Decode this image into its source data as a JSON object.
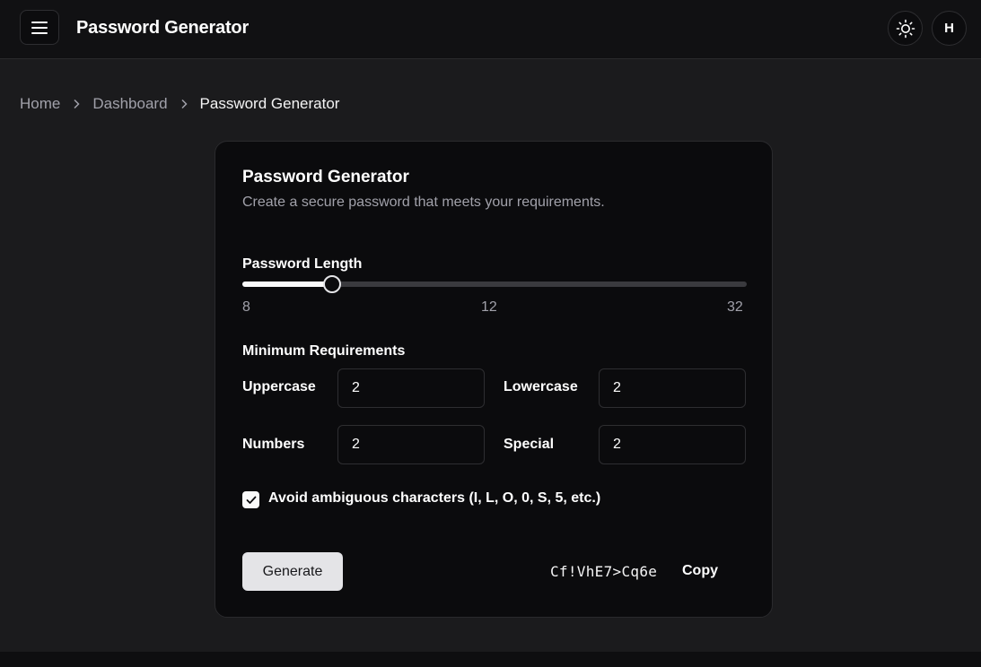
{
  "header": {
    "title": "Password Generator",
    "avatar_initial": "H"
  },
  "icons": {
    "menu": "hamburger-icon",
    "theme": "sun-icon",
    "breadcrumb_separator": "chevron-right-icon",
    "checkbox": "check-icon"
  },
  "breadcrumb": {
    "items": [
      "Home",
      "Dashboard",
      "Password Generator"
    ]
  },
  "card": {
    "title": "Password Generator",
    "description": "Create a secure password that meets your requirements.",
    "length": {
      "label": "Password Length",
      "min": 8,
      "max": 32,
      "value": 12,
      "min_label": "8",
      "value_label": "12",
      "max_label": "32"
    },
    "requirements": {
      "label": "Minimum Requirements",
      "uppercase_label": "Uppercase",
      "uppercase_value": "2",
      "lowercase_label": "Lowercase",
      "lowercase_value": "2",
      "numbers_label": "Numbers",
      "numbers_value": "2",
      "special_label": "Special",
      "special_value": "2"
    },
    "avoid_ambiguous": {
      "label": "Avoid ambiguous characters (I, L, O, 0, S, 5, etc.)",
      "checked": true
    },
    "generate_label": "Generate",
    "password": "Cf!VhE7>Cq6e",
    "copy_label": "Copy"
  },
  "colors": {
    "background": "#1b1b1d",
    "card": "#0b0b0d",
    "accent": "#fafafa",
    "muted_text": "#a1a1aa"
  }
}
